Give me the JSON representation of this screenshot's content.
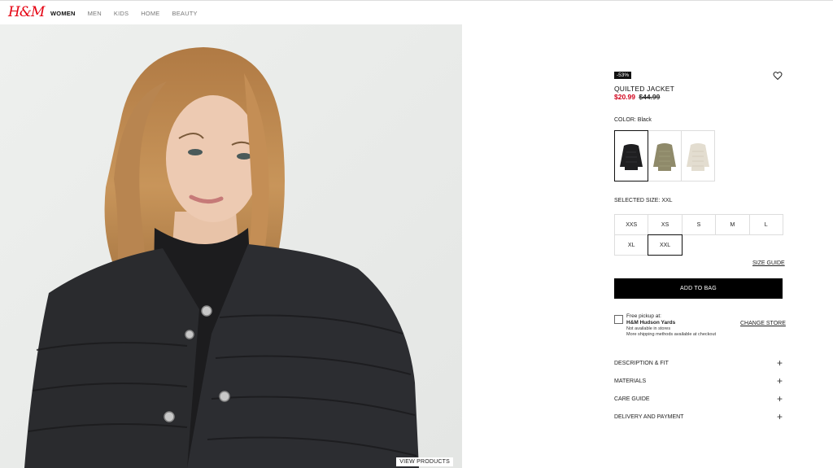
{
  "header": {
    "logo": "H&M",
    "nav": [
      "WOMEN",
      "MEN",
      "KIDS",
      "HOME",
      "BEAUTY"
    ]
  },
  "hero": {
    "view_products": "VIEW PRODUCTS"
  },
  "product": {
    "discount_badge": "-53%",
    "title": "QUILTED JACKET",
    "price_sale": "$20.99",
    "price_original": "$44.99",
    "color_label": "COLOR: Black",
    "swatches": [
      "black",
      "khaki",
      "cream"
    ],
    "selected_size_label": "SELECTED SIZE: XXL",
    "sizes": [
      "XXS",
      "XS",
      "S",
      "M",
      "L",
      "XL",
      "XXL"
    ],
    "selected_size": "XXL",
    "size_guide": "SIZE GUIDE",
    "add_to_bag": "ADD TO BAG"
  },
  "pickup": {
    "line1": "Free pickup at:",
    "store": "H&M Hudson Yards",
    "line3": "Not available in stores",
    "line4": "More shipping methods available at checkout",
    "change_store": "CHANGE STORE"
  },
  "accordion": [
    "DESCRIPTION & FIT",
    "MATERIALS",
    "CARE GUIDE",
    "DELIVERY AND PAYMENT"
  ],
  "colors": {
    "sale": "#d0021b",
    "brand": "#e50010",
    "button": "#000000"
  }
}
